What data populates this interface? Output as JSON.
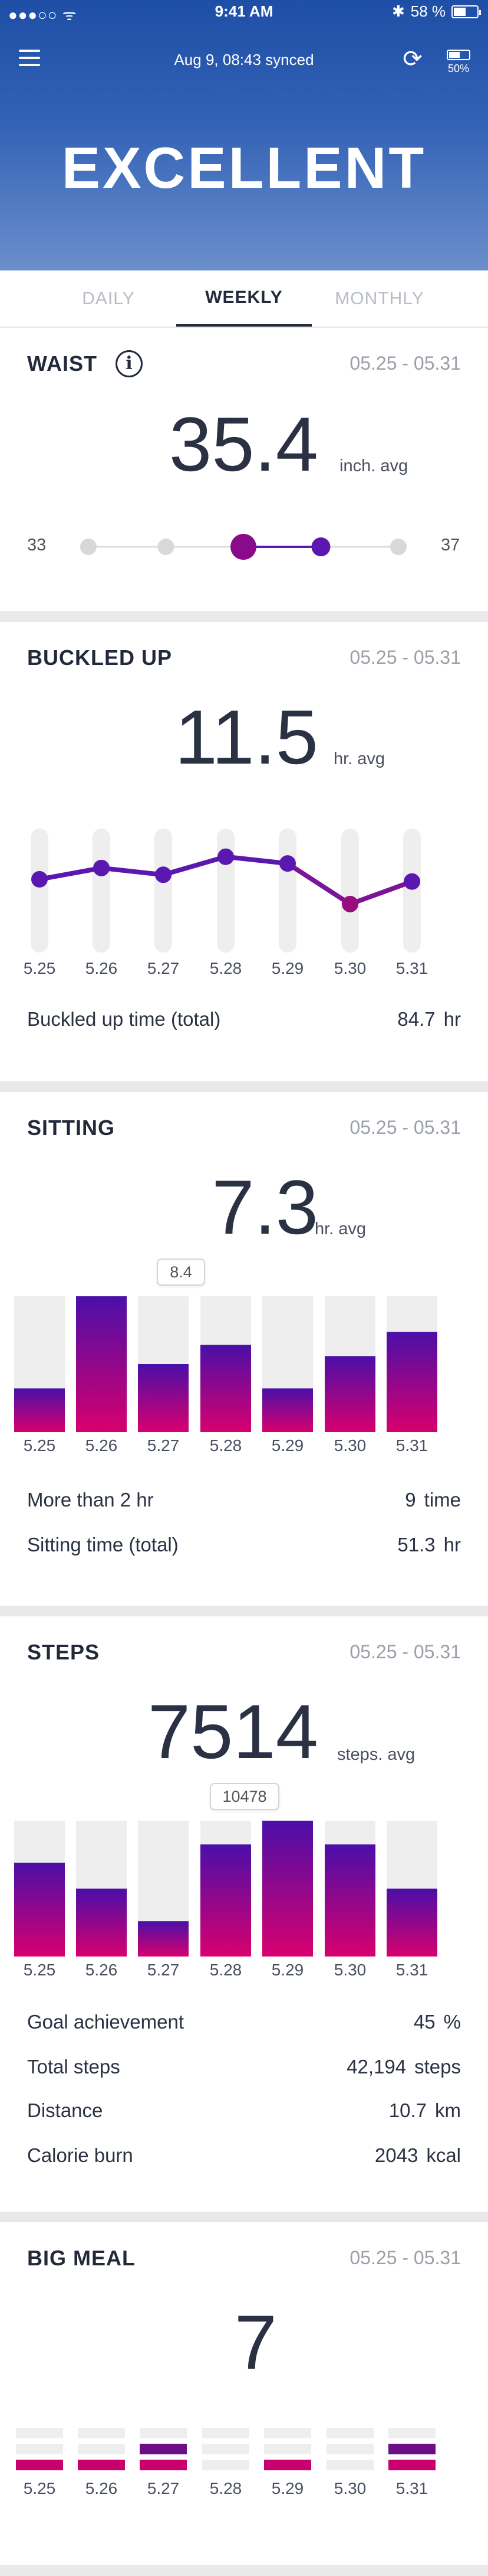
{
  "statusbar": {
    "carrier": "●●●○○ ᯤ",
    "time": "9:41 AM",
    "bt": "✱",
    "battery": "58 %"
  },
  "header": {
    "sync": "Aug 9, 08:43 synced",
    "battery_pct": "50%",
    "status": "EXCELLENT"
  },
  "tabs": [
    "DAILY",
    "WEEKLY",
    "MONTHLY"
  ],
  "colors": {
    "bar_top": "#4a0fa8",
    "bar_bottom": "#d8006e",
    "line": "#5a18b0",
    "track": "#eeeeef"
  },
  "waist": {
    "title": "WAIST",
    "range": "05.25 - 05.31",
    "value": "35.4",
    "unit": "inch. avg",
    "min_label": "33",
    "max_label": "37",
    "chart_data": {
      "type": "scatter",
      "min": 33,
      "max": 37,
      "dots": [
        33,
        34,
        35,
        36,
        37
      ],
      "avg": 35.4,
      "marker": 35,
      "end": 36
    }
  },
  "buckled": {
    "title": "BUCKLED UP",
    "range": "05.25 - 05.31",
    "value": "11.5",
    "unit": "hr. avg",
    "total_label": "Buckled up time (total)",
    "total_value": "84.7",
    "total_unit": "hr",
    "chart_data": {
      "type": "line",
      "categories": [
        "5.25",
        "5.26",
        "5.27",
        "5.28",
        "5.29",
        "5.30",
        "5.31"
      ],
      "values": [
        11.5,
        12.5,
        11.9,
        13.5,
        12.9,
        9.3,
        11.3
      ],
      "ylim": [
        5,
        16
      ]
    }
  },
  "sitting": {
    "title": "SITTING",
    "range": "05.25 - 05.31",
    "value": "7.3",
    "unit": "hr. avg",
    "tooltip": "8.4",
    "more_label": "More than 2 hr",
    "more_value": "9",
    "more_unit": "time",
    "total_label": "Sitting time (total)",
    "total_value": "51.3",
    "total_unit": "hr",
    "chart_data": {
      "type": "bar",
      "categories": [
        "5.25",
        "5.26",
        "5.27",
        "5.28",
        "5.29",
        "5.30",
        "5.31"
      ],
      "values": [
        2.7,
        8.4,
        4.2,
        5.4,
        2.7,
        4.7,
        6.2
      ],
      "ylim": [
        0,
        8.4
      ]
    }
  },
  "steps": {
    "title": "STEPS",
    "range": "05.25 - 05.31",
    "value": "7514",
    "unit": "steps. avg",
    "tooltip": "10478",
    "goal_label": "Goal achievement",
    "goal_value": "45",
    "goal_unit": "%",
    "total_label": "Total steps",
    "total_value": "42,194",
    "total_unit": "steps",
    "dist_label": "Distance",
    "dist_value": "10.7",
    "dist_unit": "km",
    "cal_label": "Calorie burn",
    "cal_value": "2043",
    "cal_unit": "kcal",
    "chart_data": {
      "type": "bar",
      "categories": [
        "5.25",
        "5.26",
        "5.27",
        "5.28",
        "5.29",
        "5.30",
        "5.31"
      ],
      "values": [
        6900,
        5000,
        2600,
        8250,
        10478,
        8250,
        5000
      ],
      "ylim": [
        0,
        10000
      ]
    }
  },
  "bigmeal": {
    "title": "BIG MEAL",
    "range": "05.25 - 05.31",
    "value": "7",
    "chart_data": {
      "type": "bar",
      "categories": [
        "5.25",
        "5.26",
        "5.27",
        "5.28",
        "5.29",
        "5.30",
        "5.31"
      ],
      "values": [
        1,
        1,
        2,
        0,
        1,
        0,
        2
      ],
      "ylim": [
        0,
        3
      ]
    }
  }
}
